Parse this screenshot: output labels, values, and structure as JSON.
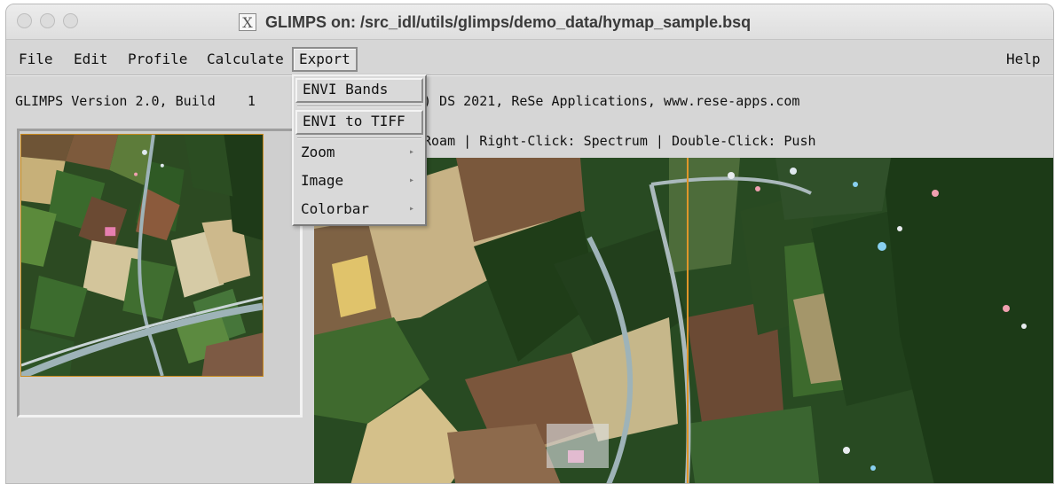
{
  "window": {
    "title": "GLIMPS on: /src_idl/utils/glimps/demo_data/hymap_sample.bsq",
    "icon": "x11-icon"
  },
  "menubar": {
    "file": "File",
    "edit": "Edit",
    "profile": "Profile",
    "calculate": "Calculate",
    "export": "Export",
    "help": "Help"
  },
  "export_menu": {
    "items": [
      {
        "label": "ENVI Bands"
      },
      {
        "label": "ENVI to TIFF"
      },
      {
        "label": "Zoom",
        "arrow": "▸"
      },
      {
        "label": "Image",
        "arrow": "▸"
      },
      {
        "label": "Colorbar",
        "arrow": "▸"
      }
    ]
  },
  "info": {
    "version": "GLIMPS Version 2.0, Build    1",
    "copyright": ") DS 2021, ReSe Applications, www.rese-apps.com",
    "hint": "Roam | Right-Click: Spectrum | Double-Click: Push"
  },
  "colors": {
    "cursor_line": "#e0962a",
    "window_bg": "#d6d6d6"
  }
}
